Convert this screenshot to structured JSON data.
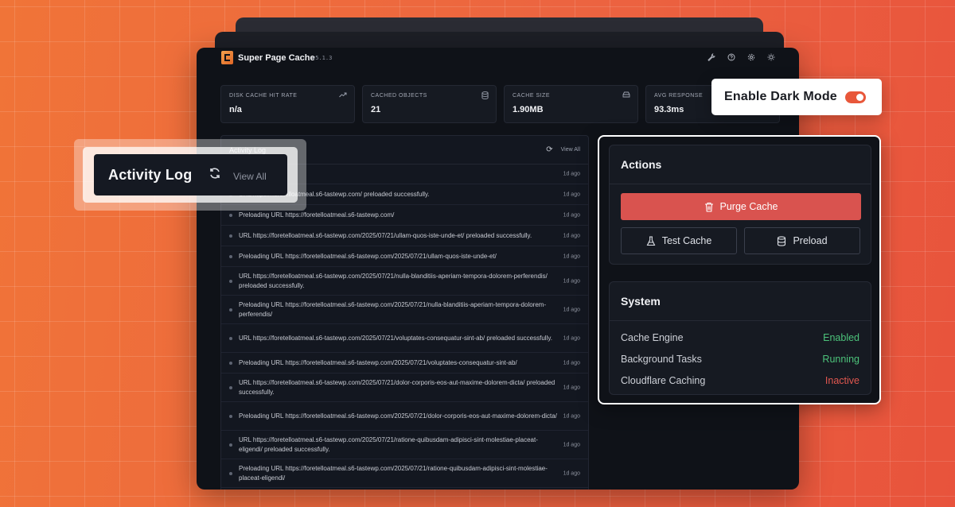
{
  "app": {
    "title": "Super Page Cache",
    "version": "v5.1.3"
  },
  "header_icons": [
    "wrench-icon",
    "help-icon",
    "gear-icon",
    "sun-icon"
  ],
  "stats": [
    {
      "label": "DISK CACHE HIT RATE",
      "value": "n/a",
      "icon": "trend-up-icon"
    },
    {
      "label": "CACHED OBJECTS",
      "value": "21",
      "icon": "database-icon"
    },
    {
      "label": "CACHE SIZE",
      "value": "1.90MB",
      "icon": "drive-icon"
    },
    {
      "label": "AVG RESPONSE",
      "value": "93.3ms",
      "icon": ""
    }
  ],
  "activity": {
    "title": "Activity Log",
    "view_all": "View All",
    "rows": [
      {
        "text": "",
        "time": "1d ago"
      },
      {
        "text": "URL https://foretelloatmeal.s6-tastewp.com/ preloaded successfully.",
        "time": "1d ago"
      },
      {
        "text": "Preloading URL https://foretelloatmeal.s6-tastewp.com/",
        "time": "1d ago"
      },
      {
        "text": "URL https://foretelloatmeal.s6-tastewp.com/2025/07/21/ullam-quos-iste-unde-et/ preloaded successfully.",
        "time": "1d ago"
      },
      {
        "text": "Preloading URL https://foretelloatmeal.s6-tastewp.com/2025/07/21/ullam-quos-iste-unde-et/",
        "time": "1d ago"
      },
      {
        "text": "URL https://foretelloatmeal.s6-tastewp.com/2025/07/21/nulla-blanditiis-aperiam-tempora-dolorem-perferendis/ preloaded successfully.",
        "time": "1d ago"
      },
      {
        "text": "Preloading URL https://foretelloatmeal.s6-tastewp.com/2025/07/21/nulla-blanditiis-aperiam-tempora-dolorem-perferendis/",
        "time": "1d ago"
      },
      {
        "text": "URL https://foretelloatmeal.s6-tastewp.com/2025/07/21/voluptates-consequatur-sint-ab/ preloaded successfully.",
        "time": "1d ago"
      },
      {
        "text": "Preloading URL https://foretelloatmeal.s6-tastewp.com/2025/07/21/voluptates-consequatur-sint-ab/",
        "time": "1d ago"
      },
      {
        "text": "URL https://foretelloatmeal.s6-tastewp.com/2025/07/21/dolor-corporis-eos-aut-maxime-dolorem-dicta/ preloaded successfully.",
        "time": "1d ago"
      },
      {
        "text": "Preloading URL https://foretelloatmeal.s6-tastewp.com/2025/07/21/dolor-corporis-eos-aut-maxime-dolorem-dicta/",
        "time": "1d ago"
      },
      {
        "text": "URL https://foretelloatmeal.s6-tastewp.com/2025/07/21/ratione-quibusdam-adipisci-sint-molestiae-placeat-eligendi/ preloaded successfully.",
        "time": "1d ago"
      },
      {
        "text": "Preloading URL https://foretelloatmeal.s6-tastewp.com/2025/07/21/ratione-quibusdam-adipisci-sint-molestiae-placeat-eligendi/",
        "time": "1d ago"
      }
    ]
  },
  "actions": {
    "title": "Actions",
    "purge": "Purge Cache",
    "test": "Test Cache",
    "preload": "Preload"
  },
  "system": {
    "title": "System",
    "rows": [
      {
        "label": "Cache Engine",
        "status": "Enabled",
        "state": "ok"
      },
      {
        "label": "Background Tasks",
        "status": "Running",
        "state": "ok"
      },
      {
        "label": "Cloudflare Caching",
        "status": "Inactive",
        "state": "bad"
      }
    ]
  },
  "dark_mode": {
    "label": "Enable Dark Mode",
    "enabled": true
  },
  "colors": {
    "accent": "#e8573a",
    "purge": "#d9534f",
    "ok": "#4cc27a",
    "bad": "#e0574f",
    "bg_panel": "#0f1218"
  }
}
